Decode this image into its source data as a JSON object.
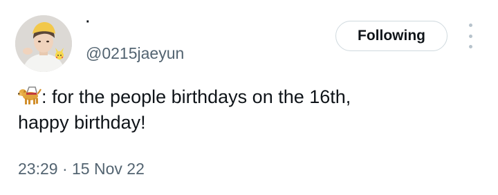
{
  "author": {
    "display_name": "·",
    "handle": "@0215jaeyun",
    "avatar_icon": "profile-photo"
  },
  "header": {
    "follow_label": "Following",
    "more_icon": "more-vertical-icon"
  },
  "tweet": {
    "emoji": "guide-dog-emoji",
    "text": ": for the people birthdays on the 16th,\nhappy birthday!",
    "time": "23:29",
    "separator": "·",
    "date": "15 Nov 22"
  },
  "colors": {
    "text_primary": "#0f1419",
    "text_secondary": "#536471",
    "button_border": "#cfd9de",
    "dots": "#b7c3cc"
  }
}
